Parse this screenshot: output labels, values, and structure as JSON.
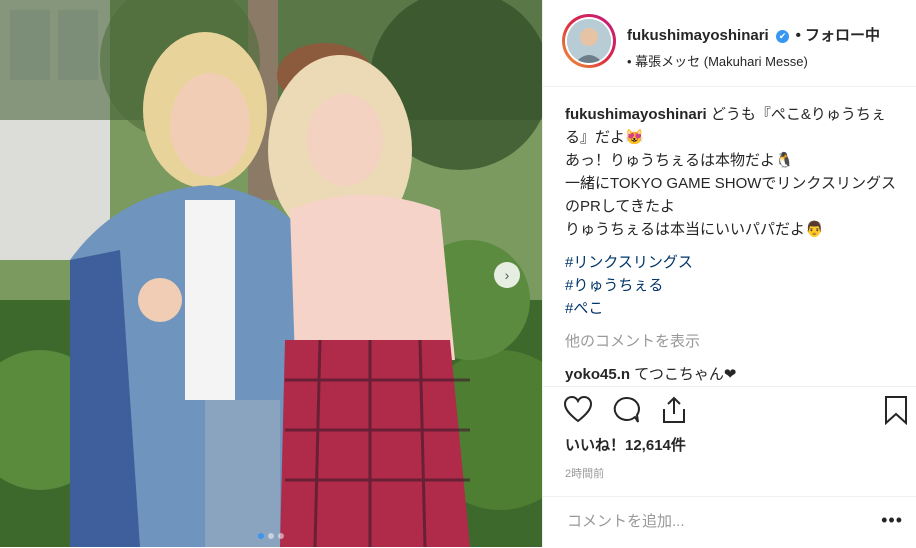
{
  "header": {
    "username": "fukushimayoshinari",
    "verified": "✔",
    "follow_label": "• フォロー中",
    "location": "• 幕張メッセ (Makuhari Messe)"
  },
  "caption": {
    "username": "fukushimayoshinari",
    "lines": [
      "どうも『ぺこ&りゅうちぇる』だよ😻",
      "あっ！りゅうちぇるは本物だよ🐧",
      "一緒にTOKYO GAME SHOWでリンクスリングスのPRしてきたよ",
      "りゅうちぇるは本当にいいパパだよ👨"
    ],
    "hashtags": [
      "#リンクスリングス",
      "#りゅうちぇる",
      "#ぺこ"
    ]
  },
  "more_comments": "他のコメントを表示",
  "reply": {
    "username": "yoko45.n",
    "text": "てつこちゃん❤"
  },
  "likes": "いいね！12,614件",
  "time": "2時間前",
  "comment_placeholder": "コメントを追加...",
  "more_icon": "•••",
  "icons": [
    "heart-icon",
    "comment-icon",
    "share-icon",
    "bookmark-icon"
  ],
  "colors": {
    "accent": "#3897f0",
    "hashtag": "#003569"
  }
}
